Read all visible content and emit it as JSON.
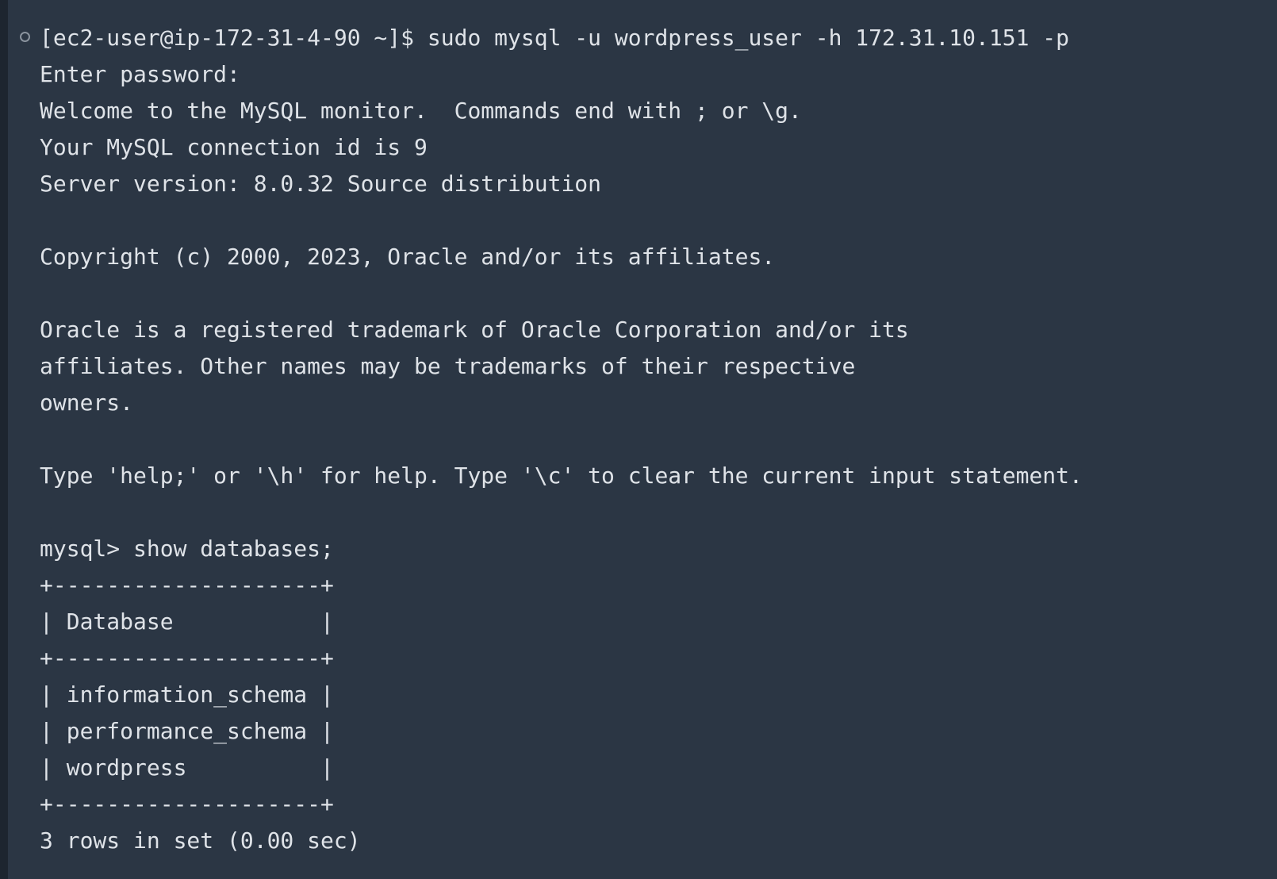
{
  "terminal": {
    "prompt_marker_icon": "circle-outline-icon",
    "background_color": "#2b3644",
    "text_color": "#dfe3e8",
    "lines": [
      "[ec2-user@ip-172-31-4-90 ~]$ sudo mysql -u wordpress_user -h 172.31.10.151 -p",
      "Enter password:",
      "Welcome to the MySQL monitor.  Commands end with ; or \\g.",
      "Your MySQL connection id is 9",
      "Server version: 8.0.32 Source distribution",
      "",
      "Copyright (c) 2000, 2023, Oracle and/or its affiliates.",
      "",
      "Oracle is a registered trademark of Oracle Corporation and/or its",
      "affiliates. Other names may be trademarks of their respective",
      "owners.",
      "",
      "Type 'help;' or '\\h' for help. Type '\\c' to clear the current input statement.",
      "",
      "mysql> show databases;",
      "+--------------------+",
      "| Database           |",
      "+--------------------+",
      "| information_schema |",
      "| performance_schema |",
      "| wordpress          |",
      "+--------------------+",
      "3 rows in set (0.00 sec)"
    ]
  }
}
